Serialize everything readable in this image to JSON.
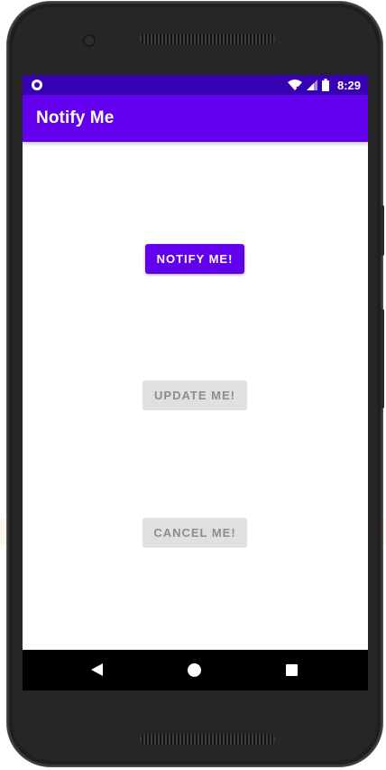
{
  "status_bar": {
    "time": "8:29",
    "icons": [
      "notification-dot-icon",
      "wifi-icon",
      "signal-icon",
      "battery-icon"
    ]
  },
  "app_bar": {
    "title": "Notify Me"
  },
  "buttons": {
    "notify": {
      "label": "NOTIFY ME!",
      "enabled": true
    },
    "update": {
      "label": "UPDATE ME!",
      "enabled": false
    },
    "cancel": {
      "label": "CANCEL ME!",
      "enabled": false
    }
  },
  "nav_bar": {
    "icons": [
      "back-icon",
      "home-icon",
      "recents-icon"
    ]
  },
  "colors": {
    "primary": "#6200ee",
    "primary_dark": "#3700b3",
    "disabled_bg": "#e0e0e0",
    "disabled_text": "#8c8c8c"
  }
}
